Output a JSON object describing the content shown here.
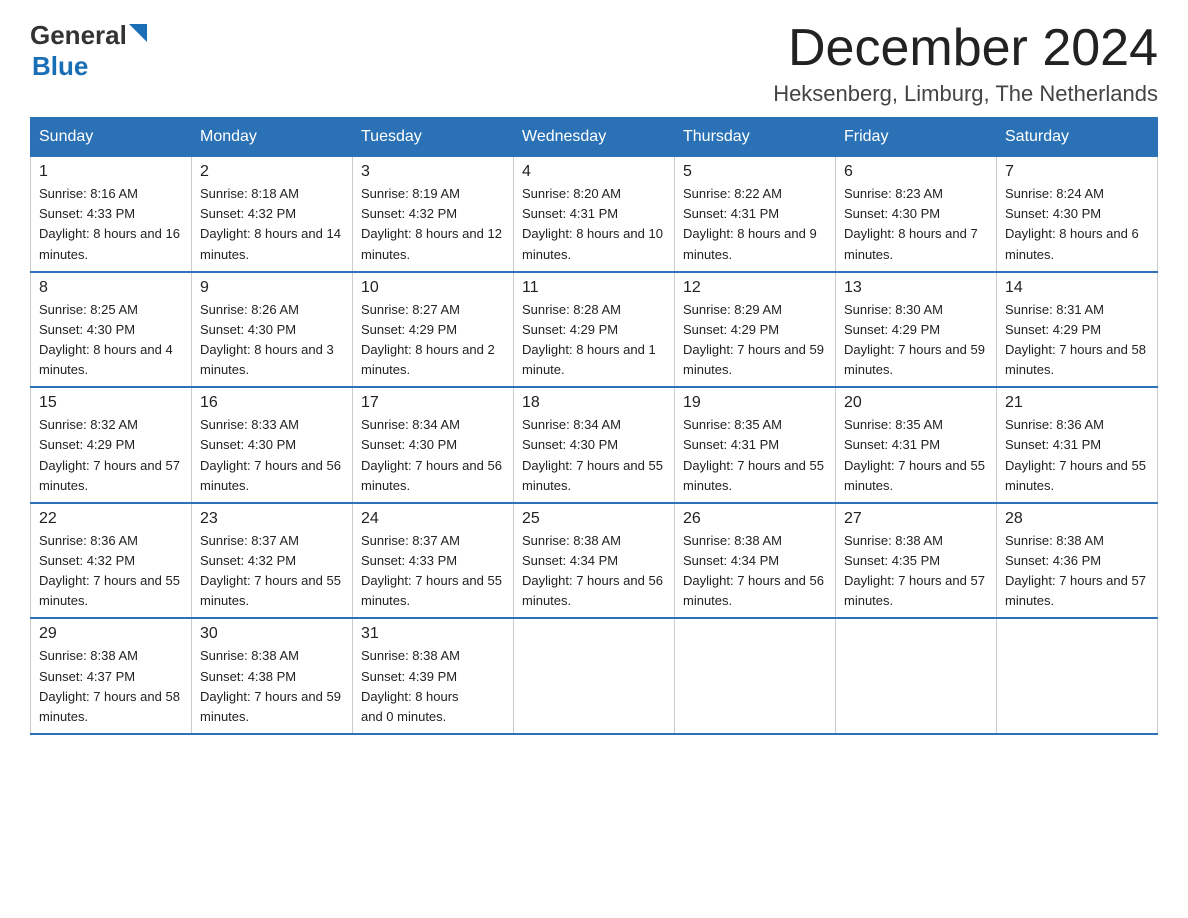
{
  "header": {
    "logo_general": "General",
    "logo_blue": "Blue",
    "month_title": "December 2024",
    "location": "Heksenberg, Limburg, The Netherlands"
  },
  "days_of_week": [
    "Sunday",
    "Monday",
    "Tuesday",
    "Wednesday",
    "Thursday",
    "Friday",
    "Saturday"
  ],
  "weeks": [
    [
      {
        "day": "1",
        "sunrise": "8:16 AM",
        "sunset": "4:33 PM",
        "daylight": "8 hours and 16 minutes."
      },
      {
        "day": "2",
        "sunrise": "8:18 AM",
        "sunset": "4:32 PM",
        "daylight": "8 hours and 14 minutes."
      },
      {
        "day": "3",
        "sunrise": "8:19 AM",
        "sunset": "4:32 PM",
        "daylight": "8 hours and 12 minutes."
      },
      {
        "day": "4",
        "sunrise": "8:20 AM",
        "sunset": "4:31 PM",
        "daylight": "8 hours and 10 minutes."
      },
      {
        "day": "5",
        "sunrise": "8:22 AM",
        "sunset": "4:31 PM",
        "daylight": "8 hours and 9 minutes."
      },
      {
        "day": "6",
        "sunrise": "8:23 AM",
        "sunset": "4:30 PM",
        "daylight": "8 hours and 7 minutes."
      },
      {
        "day": "7",
        "sunrise": "8:24 AM",
        "sunset": "4:30 PM",
        "daylight": "8 hours and 6 minutes."
      }
    ],
    [
      {
        "day": "8",
        "sunrise": "8:25 AM",
        "sunset": "4:30 PM",
        "daylight": "8 hours and 4 minutes."
      },
      {
        "day": "9",
        "sunrise": "8:26 AM",
        "sunset": "4:30 PM",
        "daylight": "8 hours and 3 minutes."
      },
      {
        "day": "10",
        "sunrise": "8:27 AM",
        "sunset": "4:29 PM",
        "daylight": "8 hours and 2 minutes."
      },
      {
        "day": "11",
        "sunrise": "8:28 AM",
        "sunset": "4:29 PM",
        "daylight": "8 hours and 1 minute."
      },
      {
        "day": "12",
        "sunrise": "8:29 AM",
        "sunset": "4:29 PM",
        "daylight": "7 hours and 59 minutes."
      },
      {
        "day": "13",
        "sunrise": "8:30 AM",
        "sunset": "4:29 PM",
        "daylight": "7 hours and 59 minutes."
      },
      {
        "day": "14",
        "sunrise": "8:31 AM",
        "sunset": "4:29 PM",
        "daylight": "7 hours and 58 minutes."
      }
    ],
    [
      {
        "day": "15",
        "sunrise": "8:32 AM",
        "sunset": "4:29 PM",
        "daylight": "7 hours and 57 minutes."
      },
      {
        "day": "16",
        "sunrise": "8:33 AM",
        "sunset": "4:30 PM",
        "daylight": "7 hours and 56 minutes."
      },
      {
        "day": "17",
        "sunrise": "8:34 AM",
        "sunset": "4:30 PM",
        "daylight": "7 hours and 56 minutes."
      },
      {
        "day": "18",
        "sunrise": "8:34 AM",
        "sunset": "4:30 PM",
        "daylight": "7 hours and 55 minutes."
      },
      {
        "day": "19",
        "sunrise": "8:35 AM",
        "sunset": "4:31 PM",
        "daylight": "7 hours and 55 minutes."
      },
      {
        "day": "20",
        "sunrise": "8:35 AM",
        "sunset": "4:31 PM",
        "daylight": "7 hours and 55 minutes."
      },
      {
        "day": "21",
        "sunrise": "8:36 AM",
        "sunset": "4:31 PM",
        "daylight": "7 hours and 55 minutes."
      }
    ],
    [
      {
        "day": "22",
        "sunrise": "8:36 AM",
        "sunset": "4:32 PM",
        "daylight": "7 hours and 55 minutes."
      },
      {
        "day": "23",
        "sunrise": "8:37 AM",
        "sunset": "4:32 PM",
        "daylight": "7 hours and 55 minutes."
      },
      {
        "day": "24",
        "sunrise": "8:37 AM",
        "sunset": "4:33 PM",
        "daylight": "7 hours and 55 minutes."
      },
      {
        "day": "25",
        "sunrise": "8:38 AM",
        "sunset": "4:34 PM",
        "daylight": "7 hours and 56 minutes."
      },
      {
        "day": "26",
        "sunrise": "8:38 AM",
        "sunset": "4:34 PM",
        "daylight": "7 hours and 56 minutes."
      },
      {
        "day": "27",
        "sunrise": "8:38 AM",
        "sunset": "4:35 PM",
        "daylight": "7 hours and 57 minutes."
      },
      {
        "day": "28",
        "sunrise": "8:38 AM",
        "sunset": "4:36 PM",
        "daylight": "7 hours and 57 minutes."
      }
    ],
    [
      {
        "day": "29",
        "sunrise": "8:38 AM",
        "sunset": "4:37 PM",
        "daylight": "7 hours and 58 minutes."
      },
      {
        "day": "30",
        "sunrise": "8:38 AM",
        "sunset": "4:38 PM",
        "daylight": "7 hours and 59 minutes."
      },
      {
        "day": "31",
        "sunrise": "8:38 AM",
        "sunset": "4:39 PM",
        "daylight": "8 hours and 0 minutes."
      },
      null,
      null,
      null,
      null
    ]
  ],
  "labels": {
    "sunrise": "Sunrise:",
    "sunset": "Sunset:",
    "daylight": "Daylight:"
  }
}
